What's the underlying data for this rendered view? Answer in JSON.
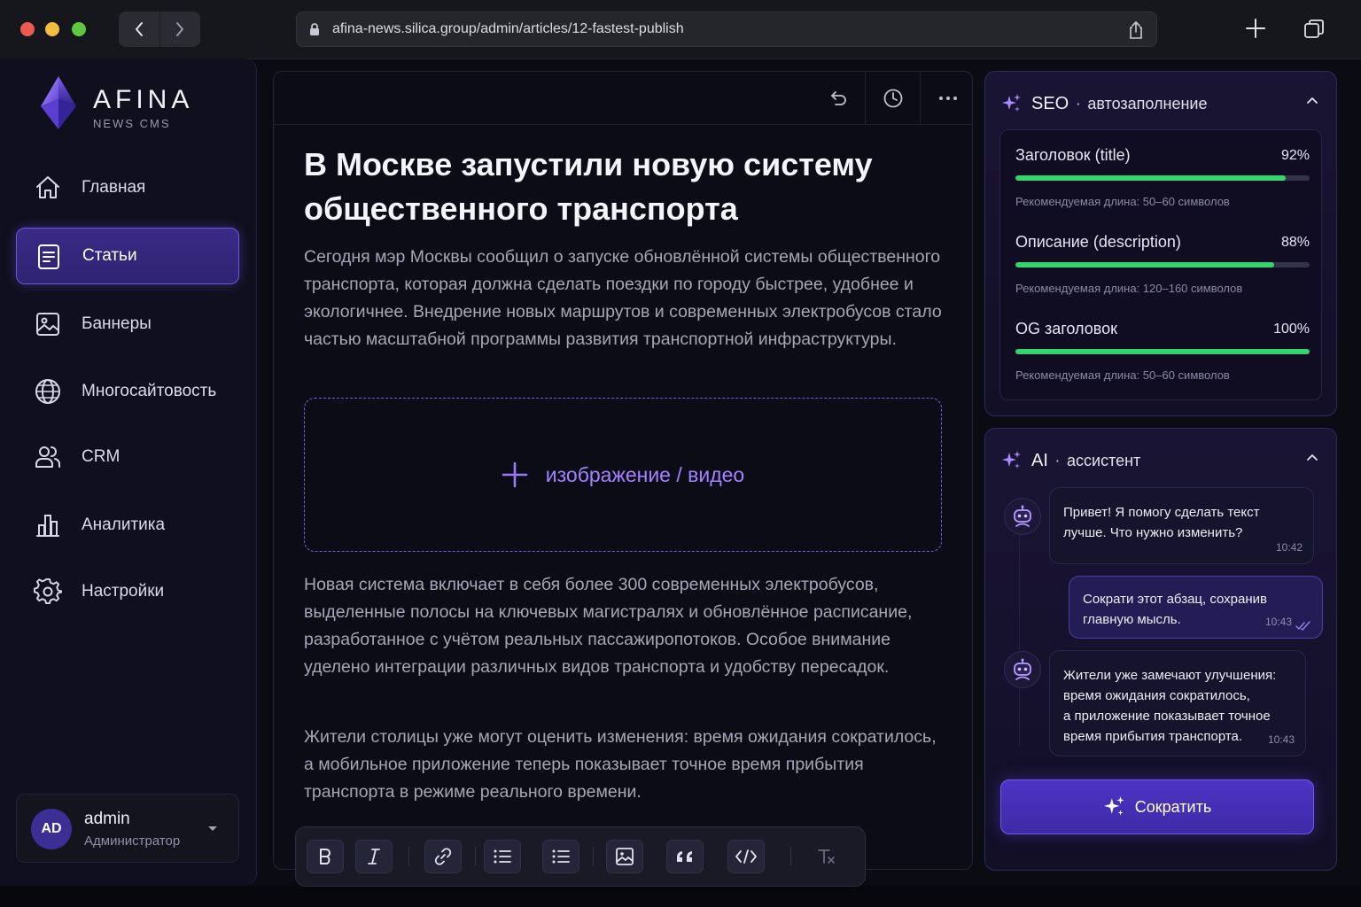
{
  "browser": {
    "url": "afina-news.silica.group/admin/articles/12-fastest-publish"
  },
  "brand": {
    "name": "AFINA",
    "subtitle": "NEWS CMS",
    "accent": "#6f56e0"
  },
  "sidebar": {
    "items": [
      {
        "label": "Главная",
        "icon": "home-icon",
        "active": false
      },
      {
        "label": "Статьи",
        "icon": "document-icon",
        "active": true
      },
      {
        "label": "Баннеры",
        "icon": "image-icon",
        "active": false
      },
      {
        "label": "Многосайтовость",
        "icon": "globe-icon",
        "active": false
      },
      {
        "label": "CRM",
        "icon": "users-icon",
        "active": false
      },
      {
        "label": "Аналитика",
        "icon": "bar-chart-icon",
        "active": false
      },
      {
        "label": "Настройки",
        "icon": "gear-icon",
        "active": false
      }
    ],
    "user": {
      "initials": "AD",
      "name": "admin",
      "role": "Администратор"
    }
  },
  "editor": {
    "title": "В Москве запустили новую систему общественного транспорта",
    "paragraphs": [
      "Сегодня мэр Москвы сообщил о запуске обновлённой системы общественного транспорта, которая должна сделать поездки по городу быстрее, удобнее и экологичнее. Внедрение новых маршрутов и современных электробусов стало частью масштабной программы развития транспортной инфраструктуры.",
      "Новая система включает в себя более 300 современных электробусов, выделенные полосы на ключевых магистралях и обновлённое расписание, разработанное с учётом реальных пассажиропотоков. Особое внимание уделено интеграции различных видов транспорта и удобству пересадок.",
      "Жители столицы уже могут оценить изменения: время ожидания сократилось, а мобильное приложение теперь показывает точное время прибытия транспорта в режиме реального времени."
    ],
    "media_placeholder": "изображение / видео",
    "top_actions": [
      "undo-icon",
      "history-icon",
      "more-icon"
    ],
    "toolbar": [
      "bold-icon",
      "italic-icon",
      "link-icon",
      "bulleted-list-icon",
      "numbered-list-icon",
      "insert-image-icon",
      "quote-icon",
      "code-icon",
      "clear-format-icon"
    ]
  },
  "seo": {
    "title": "SEO",
    "subtitle": "автозаполнение",
    "metrics": [
      {
        "name": "Заголовок (title)",
        "percent_label": "92%",
        "value": 0.92,
        "hint": "Рекомендуемая длина: 50–60 символов"
      },
      {
        "name": "Описание (description)",
        "percent_label": "88%",
        "value": 0.88,
        "hint": "Рекомендуемая длина: 120–160 символов"
      },
      {
        "name": "OG заголовок",
        "percent_label": "100%",
        "value": 1.0,
        "hint": "Рекомендуемая длина: 50–60 символов"
      }
    ],
    "bar_color": "#35d46c"
  },
  "ai": {
    "title": "AI",
    "subtitle": "ассистент",
    "messages": [
      {
        "from": "bot",
        "text": "Привет! Я помогу сделать текст\nлучше. Что нужно изменить?",
        "time": "10:42"
      },
      {
        "from": "user",
        "text": "Сократи этот абзац, сохранив\nглавную мысль.",
        "time": "10:43",
        "read": true
      },
      {
        "from": "bot",
        "text": "Жители уже замечают улучшения:\nвремя ожидания сократилось,\nа приложение показывает точное\nвремя прибытия транспорта.",
        "time": "10:43"
      }
    ],
    "action_label": "Сократить"
  }
}
